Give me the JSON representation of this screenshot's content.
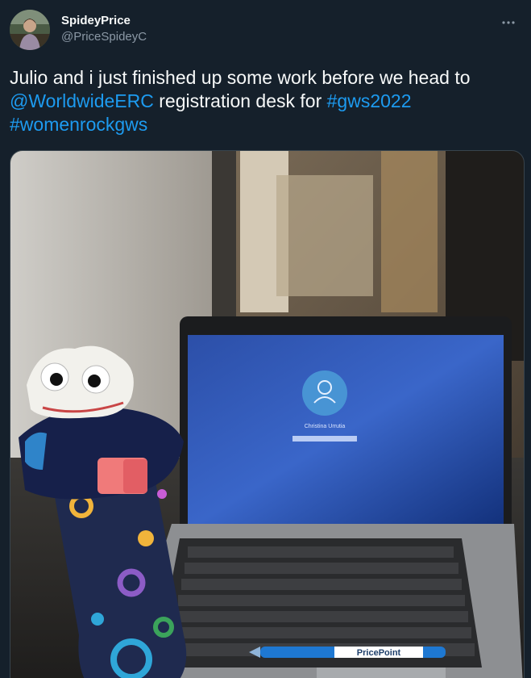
{
  "author": {
    "display_name": "SpideyPrice",
    "handle": "@PriceSpideyC",
    "avatar_icon": "avatar"
  },
  "tweet": {
    "text_lead": "Julio and i just finished up some work before we head to ",
    "mention": "@WorldwideERC",
    "text_mid": " registration desk for ",
    "hashtag_1": "#gws2022",
    "hashtag_2": "#womenrockgws"
  },
  "media": {
    "description_icon": "photo",
    "screen_user_name": "Christina Urrutia",
    "pen_brand": "PricePoint"
  },
  "colors": {
    "background": "#15202b",
    "text": "#f7f9f9",
    "secondary_text": "#8b98a5",
    "link": "#1d9bf0"
  }
}
